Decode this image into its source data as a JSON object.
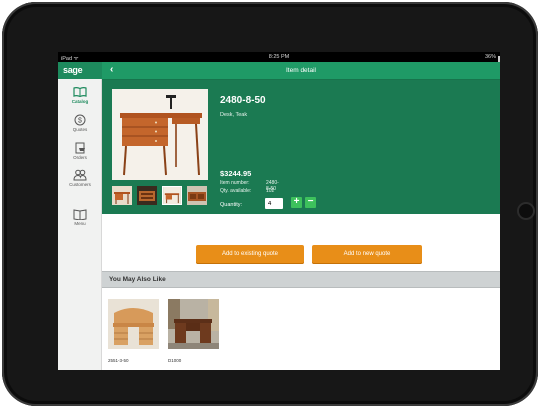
{
  "status_bar": {
    "carrier": "iPad ᯤ",
    "time": "8:25 PM",
    "battery": "36%"
  },
  "sidebar": {
    "logo": "sage",
    "items": [
      {
        "label": "Catalog",
        "icon": "book-icon",
        "active": true
      },
      {
        "label": "Quotes",
        "icon": "dollar-icon",
        "active": false
      },
      {
        "label": "Orders",
        "icon": "cart-icon",
        "active": false
      },
      {
        "label": "Customers",
        "icon": "users-icon",
        "active": false
      },
      {
        "label": "Menu",
        "icon": "menu-book-icon",
        "active": false
      }
    ]
  },
  "navbar": {
    "back": "‹",
    "title": "Item detail"
  },
  "item": {
    "title": "2480-8-50",
    "description": "Desk, Teak",
    "price": "$3244.95",
    "number_label": "Item number:",
    "number_value": "2480-8-50",
    "qty_label": "Qty. available:",
    "qty_value": "102",
    "quantity_label": "Quantity:",
    "quantity_value": "4",
    "plus": "+",
    "minus": "−"
  },
  "actions": {
    "add_existing": "Add to existing quote",
    "add_new": "Add to new quote"
  },
  "related": {
    "header": "You May Also Like",
    "items": [
      {
        "label": "2551-3-50"
      },
      {
        "label": "D1000"
      }
    ]
  },
  "colors": {
    "brand_green": "#1f9a66",
    "detail_green": "#1b7a52",
    "button_orange": "#e88e18",
    "stepper_green": "#3dc15c"
  }
}
